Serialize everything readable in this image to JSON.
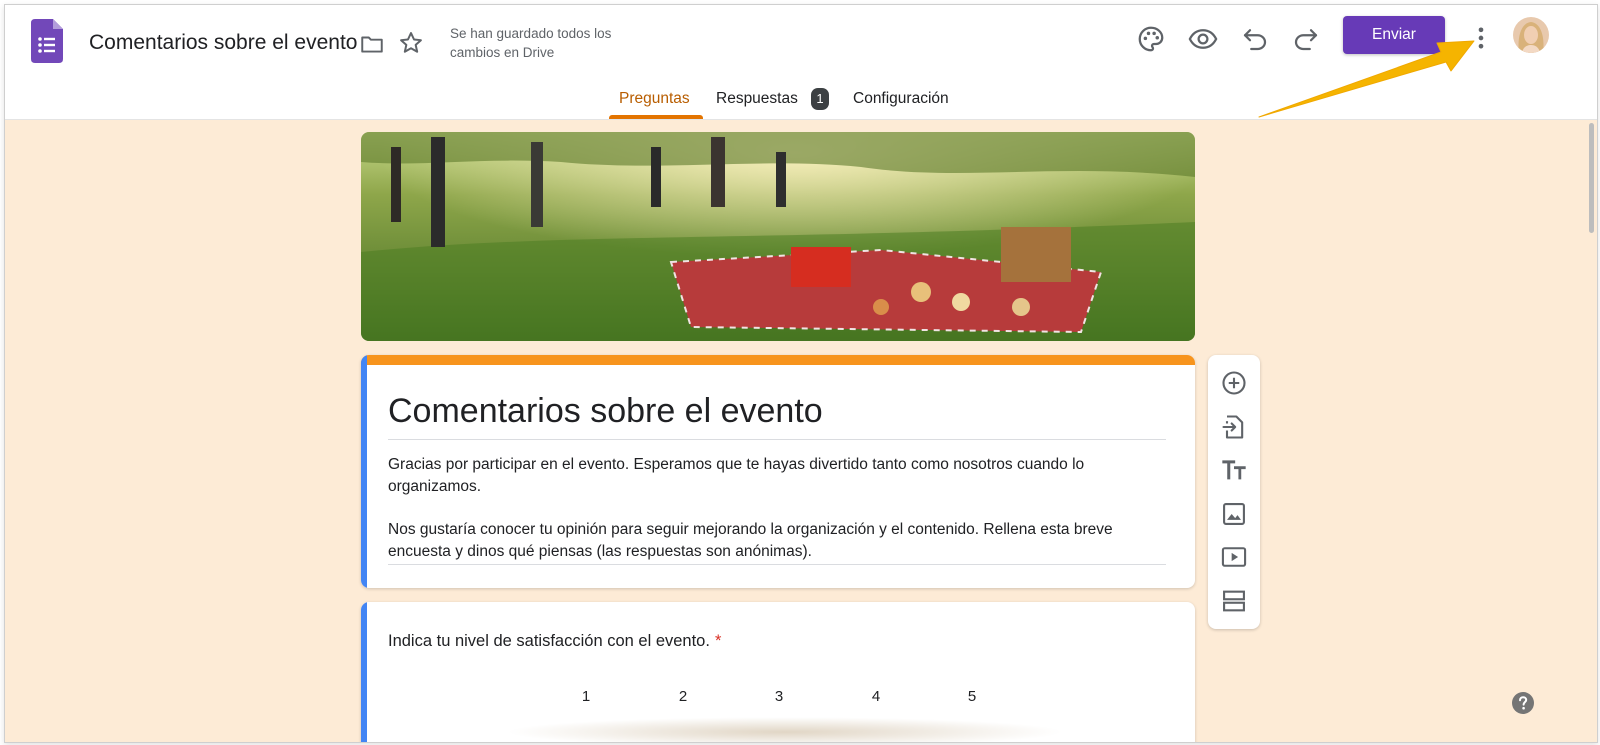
{
  "header": {
    "doc_title": "Comentarios sobre el evento",
    "saved_status": "Se han guardado todos los cambios en Drive",
    "send_label": "Enviar"
  },
  "tabs": [
    {
      "label": "Preguntas",
      "active": true
    },
    {
      "label": "Respuestas",
      "badge": "1"
    },
    {
      "label": "Configuración"
    }
  ],
  "form": {
    "title": "Comentarios sobre el evento",
    "description": [
      "Gracias por participar en el evento. Esperamos que te hayas divertido tanto como nosotros cuando lo organizamos.",
      "Nos gustaría conocer tu opinión para seguir mejorando la organización y el contenido. Rellena esta breve encuesta y dinos qué piensas (las respuestas son anónimas)."
    ]
  },
  "question": {
    "text": "Indica tu nivel de satisfacción con el evento.",
    "required_mark": "*",
    "scale": [
      "1",
      "2",
      "3",
      "4",
      "5"
    ]
  },
  "toolbar_icons": [
    "palette-icon",
    "eye-icon",
    "undo-icon",
    "redo-icon",
    "more-vert-icon"
  ],
  "side_tools": [
    "add-question-icon",
    "import-questions-icon",
    "add-title-icon",
    "add-image-icon",
    "add-video-icon",
    "add-section-icon"
  ],
  "colors": {
    "accent": "#673ab7",
    "theme_orange": "#f7941d",
    "background": "#fdebd6",
    "active_tab": "#b85d00",
    "arrow": "#f5b400"
  }
}
